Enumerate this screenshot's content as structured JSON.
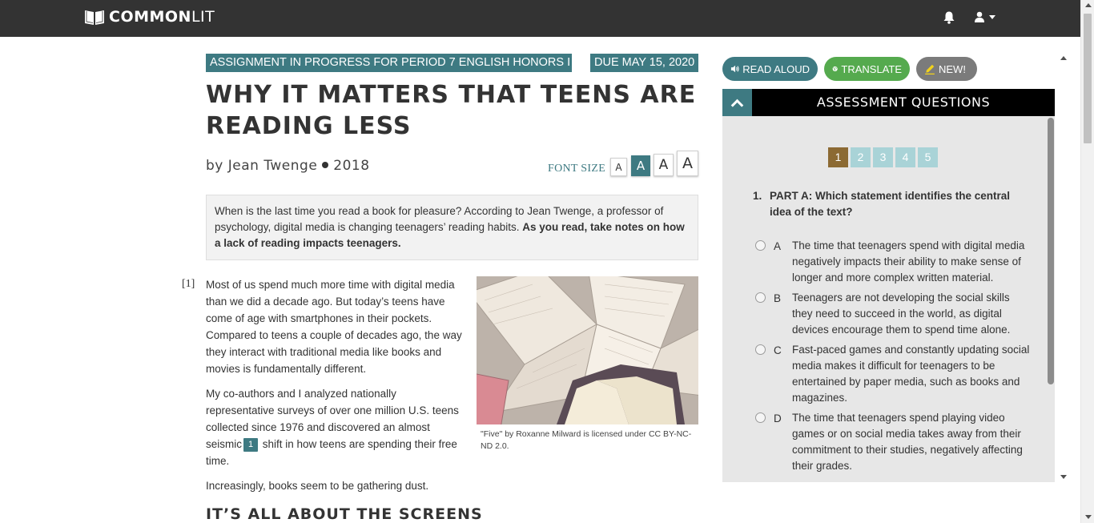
{
  "nav": {
    "logo_bold": "COMMON",
    "logo_light": "LIT"
  },
  "assignment": {
    "status": "ASSIGNMENT IN PROGRESS FOR PERIOD 7 ENGLISH HONORS I",
    "due": "DUE MAY 15, 2020"
  },
  "article": {
    "title": "WHY IT MATTERS THAT TEENS ARE READING LESS",
    "author": "by Jean Twenge",
    "year": "2018",
    "font_size_label": "FONT SIZE",
    "font_sizes": [
      "A",
      "A",
      "A",
      "A"
    ],
    "intro_plain": "When is the last time you read a book for pleasure? According to Jean Twenge, a professor of psychology, digital media is changing teenagers’ reading habits. ",
    "intro_bold": "As you read, take notes on how a lack of reading impacts teenagers.",
    "paragraph_number": "[1]",
    "p1": "Most of us spend much more time with digital media than we did a decade ago. But today’s teens have come of age with smartphones in their pockets. Compared to teens a couple of decades ago, the way they interact with traditional media like books and movies is fundamentally different.",
    "p2_before": "My co-authors and I analyzed nationally representative surveys of over one million U.S. teens collected since 1976 and discovered an almost seismic",
    "p2_annotation": "1",
    "p2_after": " shift in how teens are spending their free time.",
    "p3": "Increasingly, books seem to be gathering dust.",
    "image_caption": "\"Five\" by Roxanne Milward is licensed under CC BY-NC-ND 2.0.",
    "section_heading": "IT’S ALL ABOUT THE SCREENS"
  },
  "tools": {
    "read_aloud": "READ ALOUD",
    "translate": "TRANSLATE",
    "new": "NEW!"
  },
  "assessment": {
    "header": "ASSESSMENT QUESTIONS",
    "question_tabs": [
      "1",
      "2",
      "3",
      "4",
      "5"
    ],
    "active_question": "1",
    "question_number": "1.",
    "question_text": "PART A: Which statement identifies the central idea of the text?",
    "options": [
      {
        "letter": "A",
        "text": "The time that teenagers spend with digital media negatively impacts their ability to make sense of longer and more complex written material."
      },
      {
        "letter": "B",
        "text": "Teenagers are not developing the social skills they need to succeed in the world, as digital devices encourage them to spend time alone."
      },
      {
        "letter": "C",
        "text": "Fast-paced games and constantly updating social media makes it difficult for teenagers to be entertained by paper media, such as books and magazines."
      },
      {
        "letter": "D",
        "text": "The time that teenagers spend playing video games or on social media takes away from their commitment to their studies, negatively affecting their grades."
      }
    ]
  },
  "colors": {
    "nav_bg": "#333333",
    "teal": "#3e7a82",
    "translate_green": "#55aa4e",
    "new_gray": "#7b7b7b",
    "active_tab": "#8c6a33",
    "idle_tab": "#a9d3d7"
  }
}
